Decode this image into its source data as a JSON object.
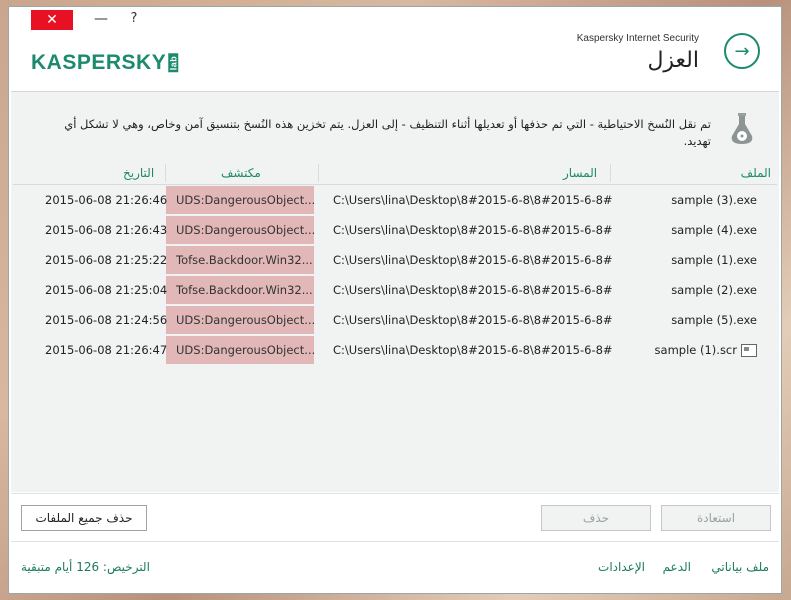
{
  "window": {
    "close_glyph": "✕",
    "minimize_glyph": "—",
    "help_glyph": "?"
  },
  "header": {
    "logo_text": "KASPERSKY",
    "logo_suffix": "lab",
    "product": "Kaspersky Internet Security",
    "title": "العزل",
    "go_glyph": "→"
  },
  "info": {
    "text": "تم نقل النُسخ الاحتياطية - التي تم حذفها أو تعديلها أثناء التنظيف - إلى العزل. يتم تخزين هذه النُسخ بتنسيق آمن وخاص، وهي لا تشكل أي تهديد."
  },
  "table": {
    "columns": {
      "name": "الملف",
      "path": "المسار",
      "detection": "مكتشف",
      "date": "التاريخ"
    },
    "rows": [
      {
        "name": "sample (3).exe",
        "path": "C:\\Users\\lina\\Desktop\\8#2015-6-8\\8#2015-6-8#",
        "detection": "UDS:DangerousObject...",
        "date": "2015-06-08 21:26:46",
        "file_icon": false
      },
      {
        "name": "sample (4).exe",
        "path": "C:\\Users\\lina\\Desktop\\8#2015-6-8\\8#2015-6-8#",
        "detection": "UDS:DangerousObject...",
        "date": "2015-06-08 21:26:43",
        "file_icon": false
      },
      {
        "name": "sample (1).exe",
        "path": "C:\\Users\\lina\\Desktop\\8#2015-6-8\\8#2015-6-8#",
        "detection": "Tofse.Backdoor.Win32...",
        "date": "2015-06-08 21:25:22",
        "file_icon": false
      },
      {
        "name": "sample (2).exe",
        "path": "C:\\Users\\lina\\Desktop\\8#2015-6-8\\8#2015-6-8#",
        "detection": "Tofse.Backdoor.Win32...",
        "date": "2015-06-08 21:25:04",
        "file_icon": false
      },
      {
        "name": "sample (5).exe",
        "path": "C:\\Users\\lina\\Desktop\\8#2015-6-8\\8#2015-6-8#",
        "detection": "UDS:DangerousObject...",
        "date": "2015-06-08 21:24:56",
        "file_icon": false
      },
      {
        "name": "sample (1).scr",
        "path": "C:\\Users\\lina\\Desktop\\8#2015-6-8\\8#2015-6-8#",
        "detection": "UDS:DangerousObject...",
        "date": "2015-06-08 21:26:47",
        "file_icon": true
      }
    ]
  },
  "buttons": {
    "delete_all": "حذف جميع الملفات",
    "delete": "حذف",
    "restore": "استعادة"
  },
  "footer": {
    "profile": "ملف بياناتي",
    "support": "الدعم",
    "settings": "الإعدادات",
    "license": "الترخيص:  126  أيام متبقية"
  },
  "colors": {
    "accent": "#1c8a6c",
    "detection_bg": "#e2b7b7",
    "close": "#e81123"
  }
}
